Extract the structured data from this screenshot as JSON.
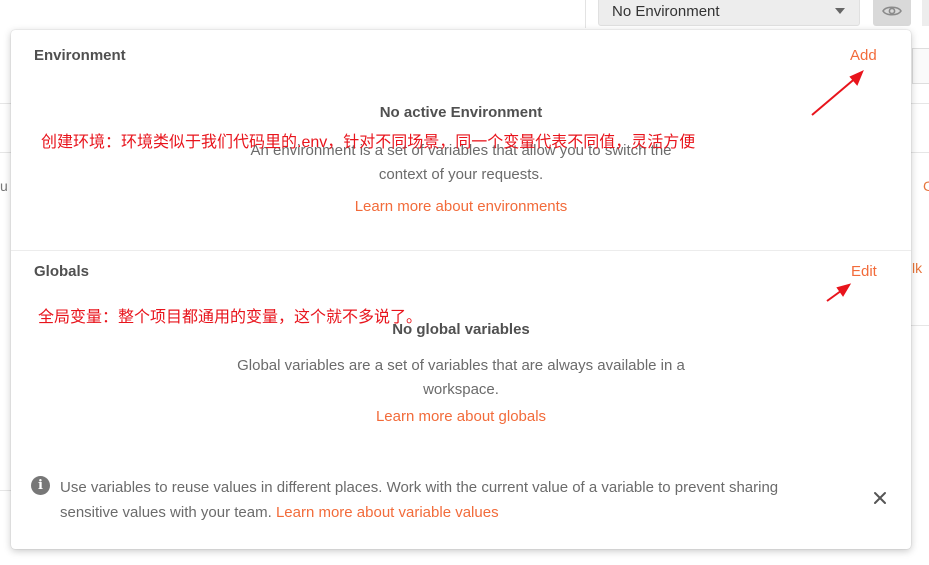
{
  "header": {
    "environment_select": {
      "value": "No Environment"
    },
    "eye_icon": "eye-icon"
  },
  "background_fragments": {
    "left_letter": "u",
    "right_letter": "C",
    "right_link": "lk"
  },
  "environment": {
    "title": "Environment",
    "add_label": "Add",
    "empty_title": "No active Environment",
    "empty_desc": "An environment is a set of variables that allow you to switch the context of your requests.",
    "learn_link": "Learn more about environments",
    "annotation": "创建环境：环境类似于我们代码里的.env，针对不同场景，同一个变量代表不同值，灵活方便"
  },
  "globals": {
    "title": "Globals",
    "edit_label": "Edit",
    "empty_title": "No global variables",
    "empty_desc": "Global variables are a set of variables that are always available in a workspace.",
    "learn_link": "Learn more about globals",
    "annotation": "全局变量：整个项目都通用的变量，这个就不多说了。"
  },
  "footer": {
    "info_icon": "info-icon",
    "text": "Use variables to reuse values in different places. Work with the current value of a variable to prevent sharing sensitive values with your team.",
    "link": "Learn more about variable values",
    "close_icon": "close-icon"
  },
  "colors": {
    "accent": "#f26b3a",
    "annotation_red": "#e8141c",
    "text": "#505050"
  }
}
